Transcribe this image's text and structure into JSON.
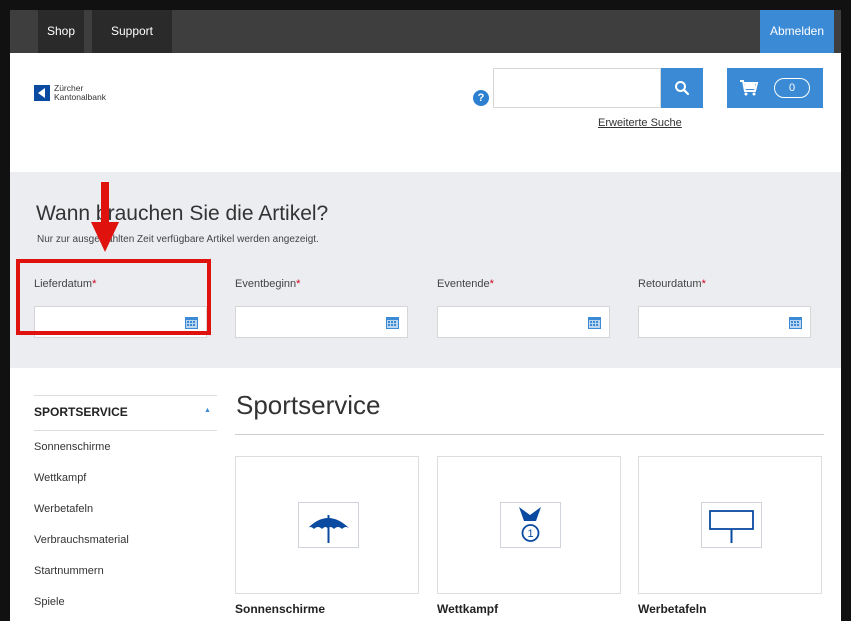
{
  "nav": {
    "shop": "Shop",
    "support": "Support",
    "logout": "Abmelden"
  },
  "header": {
    "logo_line1": "Zürcher",
    "logo_line2": "Kantonalbank",
    "help": "?",
    "search_placeholder": "",
    "advanced_search": "Erweiterte Suche",
    "cart_count": "0"
  },
  "dates": {
    "title": "Wann brauchen Sie die Artikel?",
    "subtitle": "Nur zur ausgewählten Zeit verfügbare Artikel werden angezeigt.",
    "fields": [
      {
        "label": "Lieferdatum",
        "value": ""
      },
      {
        "label": "Eventbeginn",
        "value": ""
      },
      {
        "label": "Eventende",
        "value": ""
      },
      {
        "label": "Retourdatum",
        "value": ""
      }
    ],
    "required_mark": "*"
  },
  "sidebar": {
    "title": "SPORTSERVICE",
    "caret": "▲",
    "items": [
      "Sonnenschirme",
      "Wettkampf",
      "Werbetafeln",
      "Verbrauchsmaterial",
      "Startnummern",
      "Spiele"
    ]
  },
  "main": {
    "title": "Sportservice",
    "cards": [
      {
        "name": "Sonnenschirme",
        "icon": "umbrella-icon"
      },
      {
        "name": "Wettkampf",
        "icon": "medal-icon"
      },
      {
        "name": "Werbetafeln",
        "icon": "billboard-icon"
      }
    ]
  },
  "colors": {
    "accent": "#3b8ad6",
    "topnav": "#3e3e3e",
    "band": "#ebedf1",
    "highlight": "#e0120e"
  }
}
